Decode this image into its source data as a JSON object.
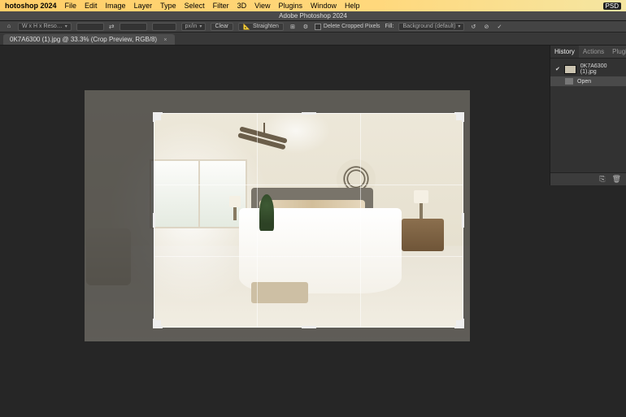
{
  "menubar": {
    "app": "hotoshop 2024",
    "items": [
      "File",
      "Edit",
      "Image",
      "Layer",
      "Type",
      "Select",
      "Filter",
      "3D",
      "View",
      "Plugins",
      "Window",
      "Help"
    ],
    "sys_badge": "PSD"
  },
  "titlebar": {
    "title": "Adobe Photoshop 2024"
  },
  "options": {
    "ratio_label": "W x H x Reso…",
    "swap": "⇄",
    "units": "px/in",
    "clear": "Clear",
    "straighten": "Straighten",
    "overlay_icon": "⊞",
    "settings_icon": "⚙",
    "delete_cropped": "Delete Cropped Pixels",
    "fill_label": "Fill:",
    "fill_value": "Background (default)",
    "reset_icon": "↺",
    "cancel_icon": "⊘",
    "commit_icon": "✓"
  },
  "doctab": {
    "name": "0K7A6300 (1).jpg @ 33.3% (Crop Preview, RGB/8)"
  },
  "panel": {
    "tabs": [
      "History",
      "Actions",
      "Plugins"
    ],
    "active_tab": 0,
    "snapshot": "0K7A6300 (1).jpg",
    "steps": [
      "Open"
    ],
    "footer_icons": [
      "⎘",
      "🗑"
    ]
  }
}
